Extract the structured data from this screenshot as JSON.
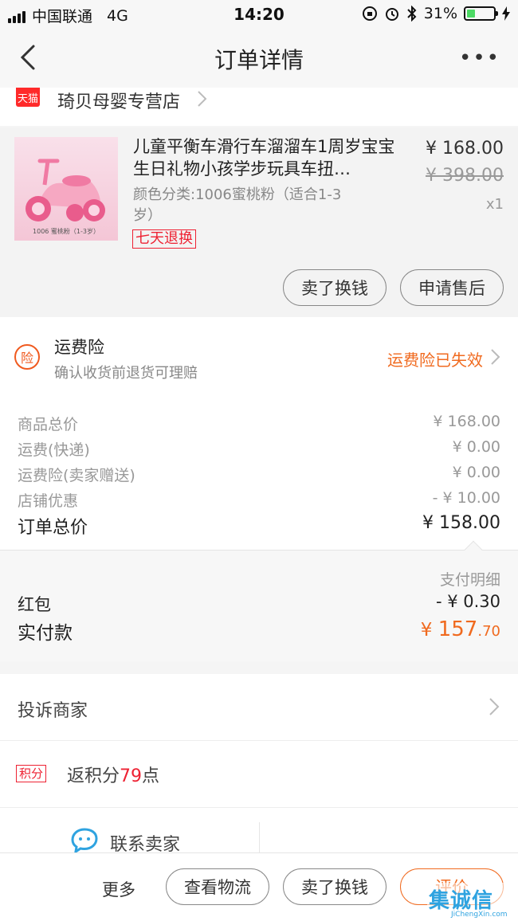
{
  "status_bar": {
    "carrier": "中国联通",
    "network": "4G",
    "time": "14:20",
    "battery": "31%",
    "battery_level": 0.31
  },
  "nav": {
    "title": "订单详情",
    "more": "•••"
  },
  "shop": {
    "badge": "天猫",
    "name": "琦贝母婴专营店"
  },
  "product": {
    "title": "儿童平衡车滑行车溜溜车1周岁宝宝生日礼物小孩学步玩具车扭…",
    "variant": "颜色分类:1006蜜桃粉（适合1-3岁）",
    "tag": "七天退换",
    "price": "¥ 168.00",
    "original_price": "¥ 398.00",
    "quantity": "x1",
    "thumb_caption": "1006 蜜桃粉（1-3岁）",
    "buttons": {
      "sell": "卖了换钱",
      "after_sale": "申请售后"
    }
  },
  "insurance": {
    "icon": "险",
    "title": "运费险",
    "subtitle": "确认收货前退货可理赔",
    "status": "运费险已失效"
  },
  "summary": {
    "rows": [
      {
        "label": "商品总价",
        "value": "¥ 168.00"
      },
      {
        "label": "运费(快递)",
        "value": "¥ 0.00"
      },
      {
        "label": "运费险(卖家赠送)",
        "value": "¥ 0.00"
      },
      {
        "label": "店铺优惠",
        "value": "- ¥ 10.00"
      }
    ],
    "total_label": "订单总价",
    "total_value": "¥ 158.00"
  },
  "payment": {
    "detail_link": "支付明细",
    "red_packet_label": "红包",
    "red_packet_value": "- ¥ 0.30",
    "paid_label": "实付款",
    "paid_currency": "¥",
    "paid_int": "157",
    "paid_dec": ".70"
  },
  "complain": {
    "label": "投诉商家"
  },
  "points": {
    "badge": "积分",
    "prefix": "返积分",
    "number": "79",
    "suffix": "点"
  },
  "contact": {
    "label": "联系卖家"
  },
  "bottom_bar": {
    "more": "更多",
    "logistics": "查看物流",
    "sell": "卖了换钱",
    "review": "评价"
  },
  "watermark": {
    "text": "集诚信",
    "sub": "JiChengXin.com"
  },
  "colors": {
    "accent": "#f06a1f",
    "red": "#ee2233",
    "tmall": "#ff2a2a"
  }
}
